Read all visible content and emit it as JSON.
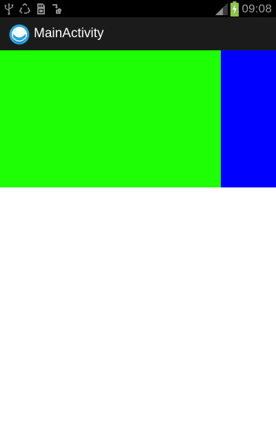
{
  "status_bar": {
    "time": "09:08",
    "icons": [
      "usb-icon",
      "recycle-icon",
      "sd-card-icon",
      "sync-icon"
    ],
    "right_icons": [
      "signal-icon",
      "battery-charging-icon"
    ]
  },
  "action_bar": {
    "title": "MainActivity",
    "app_icon": "app-logo-icon"
  },
  "colors": {
    "green_block": "#1eff06",
    "blue_block": "#0000ff",
    "action_bar": "#1b1b1b",
    "status_bar": "#000000",
    "battery_charging": "#8bc34a"
  }
}
